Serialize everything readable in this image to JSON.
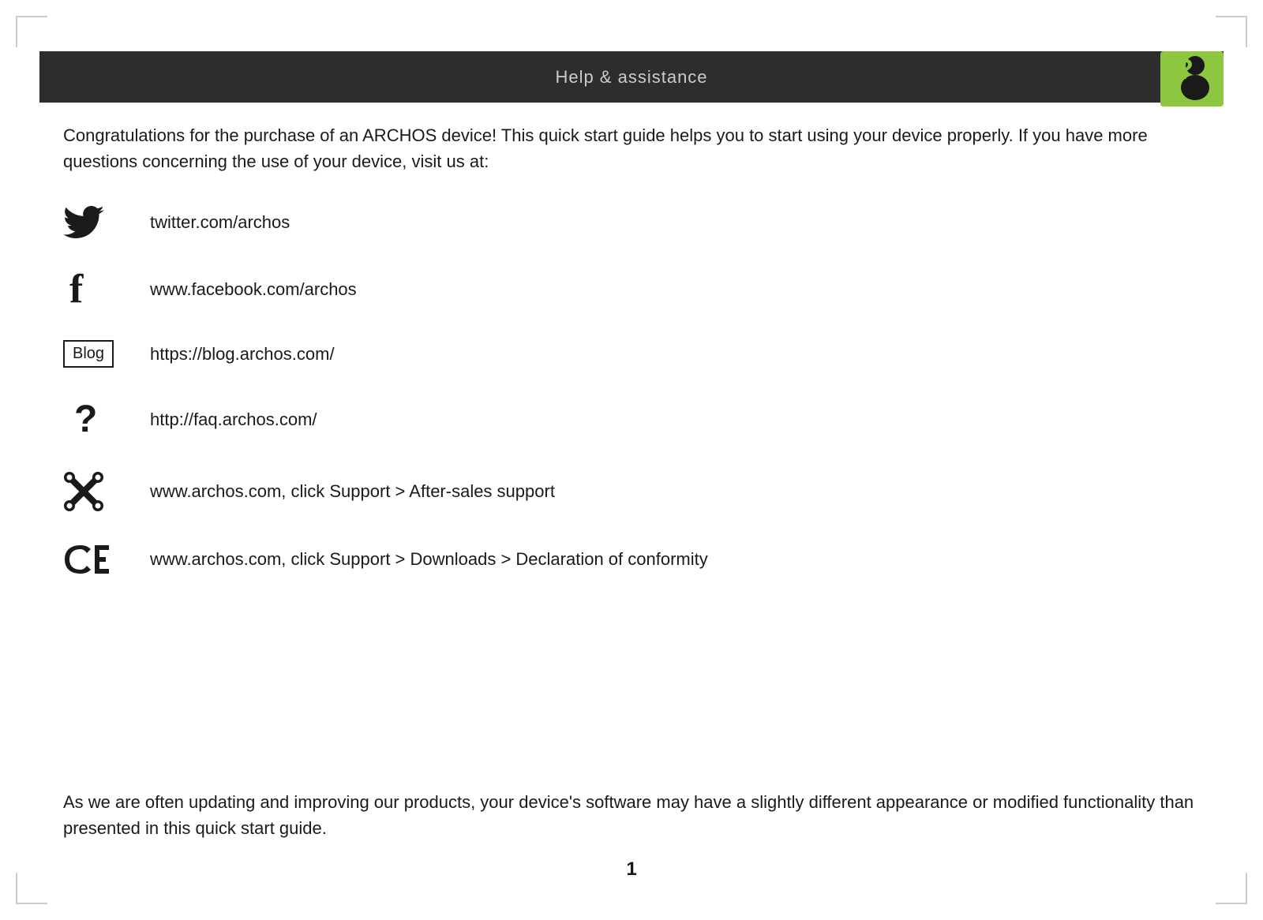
{
  "page": {
    "title": "Help & assistance",
    "page_number": "1",
    "colors": {
      "header_bg": "#2d2d2d",
      "header_text": "#cccccc",
      "body_text": "#1a1a1a",
      "accent_green": "#8dc63f"
    }
  },
  "header": {
    "title": "Help & assistance"
  },
  "content": {
    "intro": "Congratulations for the purchase of an ARCHOS device! This quick start guide helps you to start using your device properly. If you have more questions concerning the use of your device, visit us at:",
    "links": [
      {
        "icon_type": "twitter",
        "icon_label": "Twitter bird icon",
        "text": "twitter.com/archos"
      },
      {
        "icon_type": "facebook",
        "icon_label": "Facebook f icon",
        "text": "www.facebook.com/archos"
      },
      {
        "icon_type": "blog",
        "icon_label": "Blog box icon",
        "text": "https://blog.archos.com/"
      },
      {
        "icon_type": "faq",
        "icon_label": "Question mark icon",
        "text": "http://faq.archos.com/"
      },
      {
        "icon_type": "support",
        "icon_label": "Wrench cross icon",
        "text": "www.archos.com, click Support > After-sales support"
      },
      {
        "icon_type": "ce",
        "icon_label": "CE conformity mark",
        "text": "www.archos.com, click Support > Downloads > Declaration of conformity"
      }
    ],
    "footer": "As we are often updating and improving our products, your device's software may have a slightly different appearance or modified functionality than presented in this quick start guide."
  }
}
